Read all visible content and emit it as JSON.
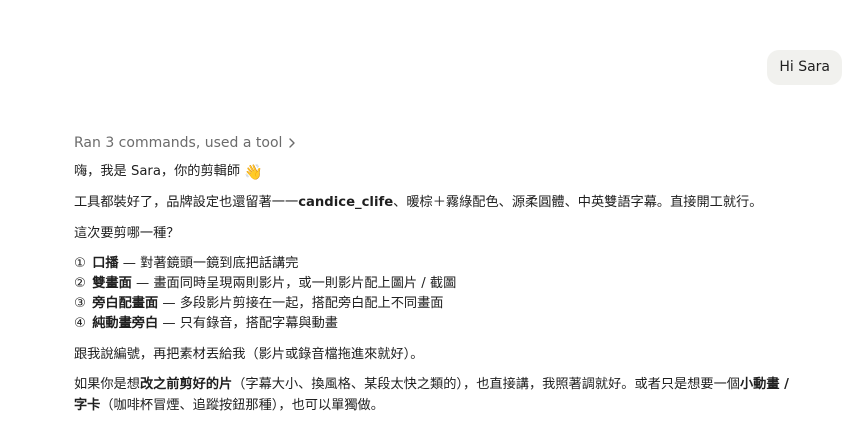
{
  "user_message": "Hi Sara",
  "tool_summary": "Ran 3 commands, used a tool",
  "greeting": {
    "text": "嗨，我是 Sara，你的剪輯師",
    "emoji": "👋"
  },
  "setup": {
    "prefix": "工具都裝好了，品牌設定也還留著一一",
    "brand": "candice_clife",
    "suffix": "、暖棕＋霧綠配色、源柔圓體、中英雙語字幕。直接開工就行。"
  },
  "question": "這次要剪哪一種？",
  "options": [
    {
      "num": "①",
      "title": "口播",
      "desc": " — 對著鏡頭一鏡到底把話講完"
    },
    {
      "num": "②",
      "title": "雙畫面",
      "desc": " — 畫面同時呈現兩則影片，或一則影片配上圖片 / 截圖"
    },
    {
      "num": "③",
      "title": "旁白配畫面",
      "desc": " — 多段影片剪接在一起，搭配旁白配上不同畫面"
    },
    {
      "num": "④",
      "title": "純動畫旁白",
      "desc": " — 只有錄音，搭配字幕與動畫"
    }
  ],
  "instruction": "跟我說編號，再把素材丟給我（影片或錄音檔拖進來就好）。",
  "closing": {
    "p1": "如果你是想",
    "b1": "改之前剪好的片",
    "p2": "（字幕大小、換風格、某段太快之類的），也直接講，我照著調就好。或者只是想要一個",
    "b2a": "小動畫 /",
    "b2b": "字卡",
    "p3": "（咖啡杯冒煙、追蹤按鈕那種），也可以單獨做。"
  },
  "icons": {
    "chevron": "chevron-right-icon"
  }
}
